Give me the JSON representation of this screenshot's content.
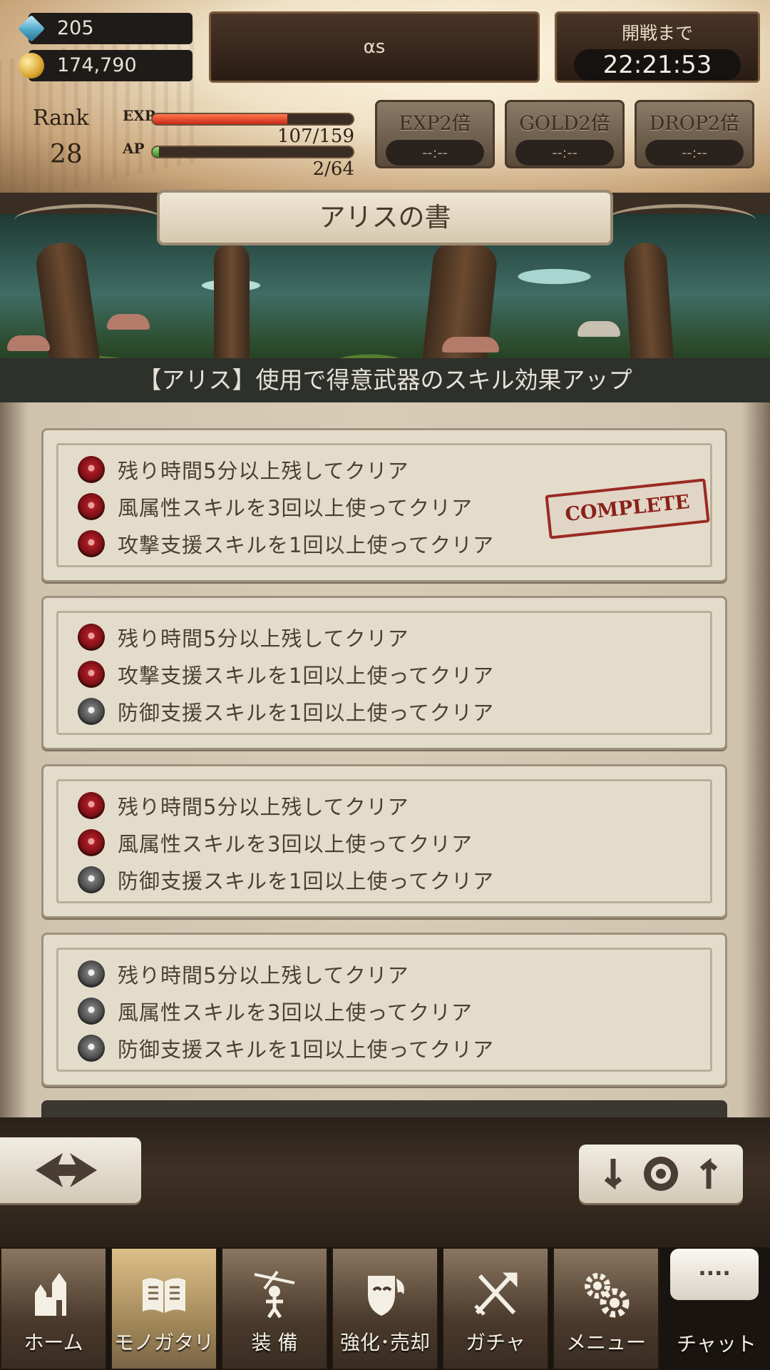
{
  "resources": {
    "gems": "205",
    "gold": "174,790"
  },
  "player": {
    "name": "αs",
    "rank_label": "Rank",
    "rank": "28",
    "exp_label": "EXP",
    "exp_value": "107/159",
    "exp_fraction": 0.673,
    "ap_label": "AP",
    "ap_value": "2/64",
    "ap_fraction": 0.031
  },
  "battle_timer": {
    "label": "開戦まで",
    "value": "22:21:53"
  },
  "boosts": [
    {
      "label": "EXP2倍",
      "time": "--:--"
    },
    {
      "label": "GOLD2倍",
      "time": "--:--"
    },
    {
      "label": "DROP2倍",
      "time": "--:--"
    }
  ],
  "book": {
    "title": "アリスの書",
    "subtitle": "【アリス】使用で得意武器のスキル効果アップ"
  },
  "missions": [
    {
      "complete": true,
      "complete_label": "COMPLETE",
      "conditions": [
        {
          "text": "残り時間5分以上残してクリア",
          "achieved": true
        },
        {
          "text": "風属性スキルを3回以上使ってクリア",
          "achieved": true
        },
        {
          "text": "攻撃支援スキルを1回以上使ってクリア",
          "achieved": true
        }
      ]
    },
    {
      "complete": false,
      "conditions": [
        {
          "text": "残り時間5分以上残してクリア",
          "achieved": true
        },
        {
          "text": "攻撃支援スキルを1回以上使ってクリア",
          "achieved": true
        },
        {
          "text": "防御支援スキルを1回以上使ってクリア",
          "achieved": false
        }
      ]
    },
    {
      "complete": false,
      "conditions": [
        {
          "text": "残り時間5分以上残してクリア",
          "achieved": true
        },
        {
          "text": "風属性スキルを3回以上使ってクリア",
          "achieved": true
        },
        {
          "text": "防御支援スキルを1回以上使ってクリア",
          "achieved": false
        }
      ]
    },
    {
      "complete": false,
      "conditions": [
        {
          "text": "残り時間5分以上残してクリア",
          "achieved": false
        },
        {
          "text": "風属性スキルを3回以上使ってクリア",
          "achieved": false
        },
        {
          "text": "防御支援スキルを1回以上使ってクリア",
          "achieved": false
        }
      ]
    }
  ],
  "nav": [
    {
      "label": "ホーム",
      "icon": "home-castle-icon"
    },
    {
      "label": "モノガタリ",
      "icon": "book-icon",
      "active": true
    },
    {
      "label": "装 備",
      "icon": "marionette-icon"
    },
    {
      "label": "強化･売却",
      "icon": "shield-mask-icon"
    },
    {
      "label": "ガチャ",
      "icon": "crossed-weapons-icon"
    },
    {
      "label": "メニュー",
      "icon": "gears-icon"
    }
  ],
  "chat": {
    "bubble": "....",
    "label": "チャット"
  },
  "colors": {
    "rose_achieved": "#b01c24",
    "rose_pending": "#6a6a6a",
    "stamp": "#9a2a24",
    "exp_bar": "#e0452a",
    "nav_active": "#c8ac78"
  }
}
